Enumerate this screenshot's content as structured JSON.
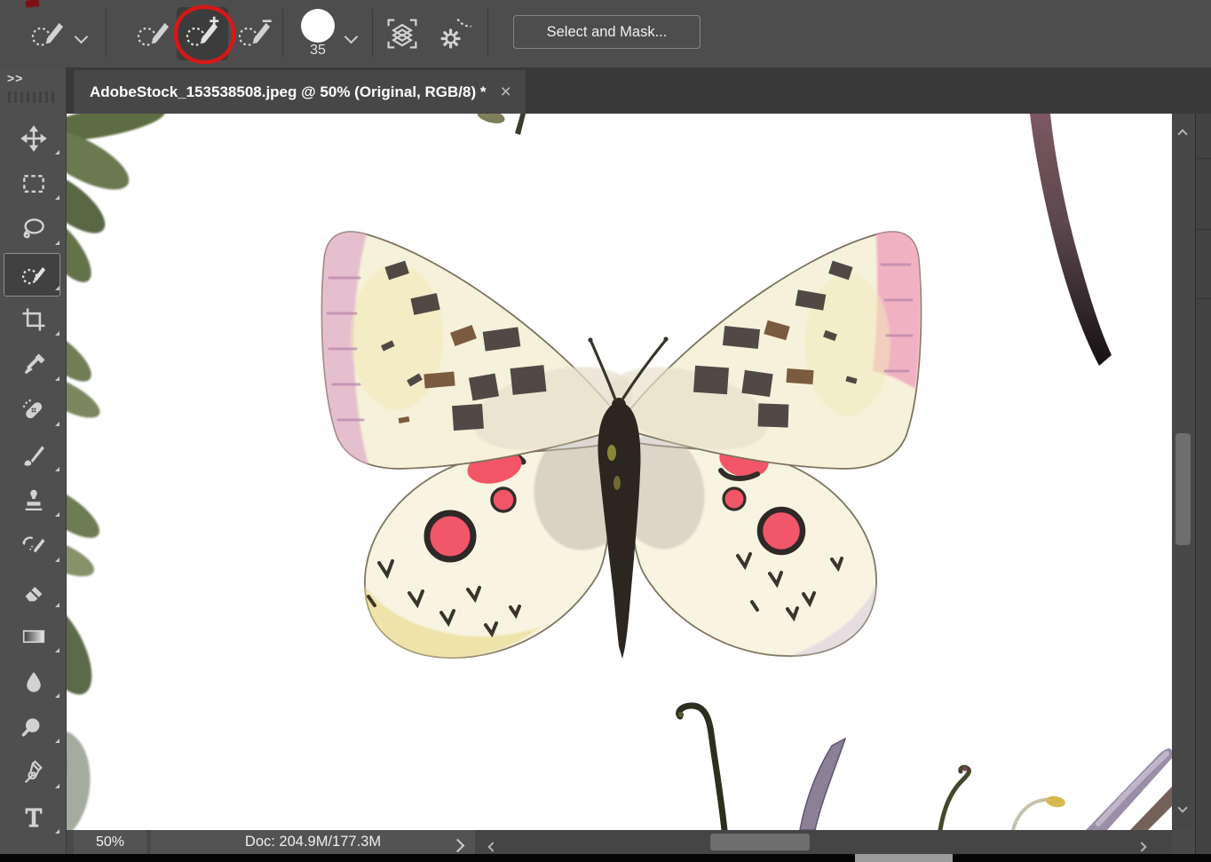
{
  "colors": {
    "panel": "#4d4d4d",
    "tabbar": "#393939",
    "annotation_red": "#dc1616",
    "icon": "#d2d2d2",
    "scrollbar_thumb": "#6e6e6e",
    "canvas": "#ffffff"
  },
  "topbar": {
    "tool_preset_icon": "selection-brush-preset-icon",
    "modes": [
      {
        "name": "new-selection",
        "active": false
      },
      {
        "name": "add-to-selection",
        "active": true
      },
      {
        "name": "subtract-from-selection",
        "active": false
      }
    ],
    "brush_size": "35",
    "sample_icon": "sample-all-layers-icon",
    "settings_icon": "brush-settings-gear-icon",
    "select_and_mask_label": "Select and Mask...",
    "annotation": {
      "shape": "hand-drawn-red-circle",
      "target": "add-to-selection"
    }
  },
  "tabbar": {
    "title": "AdobeStock_153538508.jpeg @ 50% (Original, RGB/8) *",
    "close_glyph": "×"
  },
  "sidebar": {
    "collapse_glyph": ">>",
    "active_tool": "selection-brush",
    "tools": [
      "move",
      "rectangular-marquee",
      "lasso",
      "selection-brush",
      "crop",
      "eyedropper",
      "spot-healing-brush",
      "brush",
      "clone-stamp",
      "history-brush",
      "eraser",
      "gradient",
      "blur",
      "zoom",
      "pen",
      "type"
    ]
  },
  "canvas": {
    "description": "watercolor apollo butterfly on white background with fern leaves at left edge, dark twig at top right and curved stems at bottom"
  },
  "statusbar": {
    "zoom_level": "50%",
    "doc_info": "Doc: 204.9M/177.3M"
  }
}
